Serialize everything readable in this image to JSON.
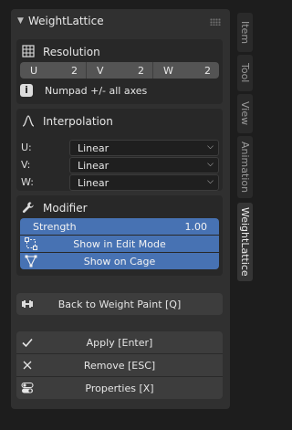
{
  "panel": {
    "title": "WeightLattice"
  },
  "resolution": {
    "title": "Resolution",
    "cells": [
      {
        "axis": "U",
        "value": "2"
      },
      {
        "axis": "V",
        "value": "2"
      },
      {
        "axis": "W",
        "value": "2"
      }
    ],
    "note": "Numpad +/- all axes"
  },
  "interpolation": {
    "title": "Interpolation",
    "rows": [
      {
        "axis": "U:",
        "value": "Linear"
      },
      {
        "axis": "V:",
        "value": "Linear"
      },
      {
        "axis": "W:",
        "value": "Linear"
      }
    ]
  },
  "modifier": {
    "title": "Modifier",
    "strength_label": "Strength",
    "strength_value": "1.00",
    "edit_mode_label": "Show in Edit Mode",
    "cage_label": "Show on Cage"
  },
  "actions": {
    "back_label": "Back to Weight Paint  [Q]",
    "apply_label": "Apply  [Enter]",
    "remove_label": "Remove  [ESC]",
    "properties_label": "Properties  [X]"
  },
  "tabs": [
    "Item",
    "Tool",
    "View",
    "Animation",
    "WeightLattice"
  ],
  "colors": {
    "accent": "#4772b3",
    "panel": "#303030",
    "background": "#1d1d1d"
  }
}
